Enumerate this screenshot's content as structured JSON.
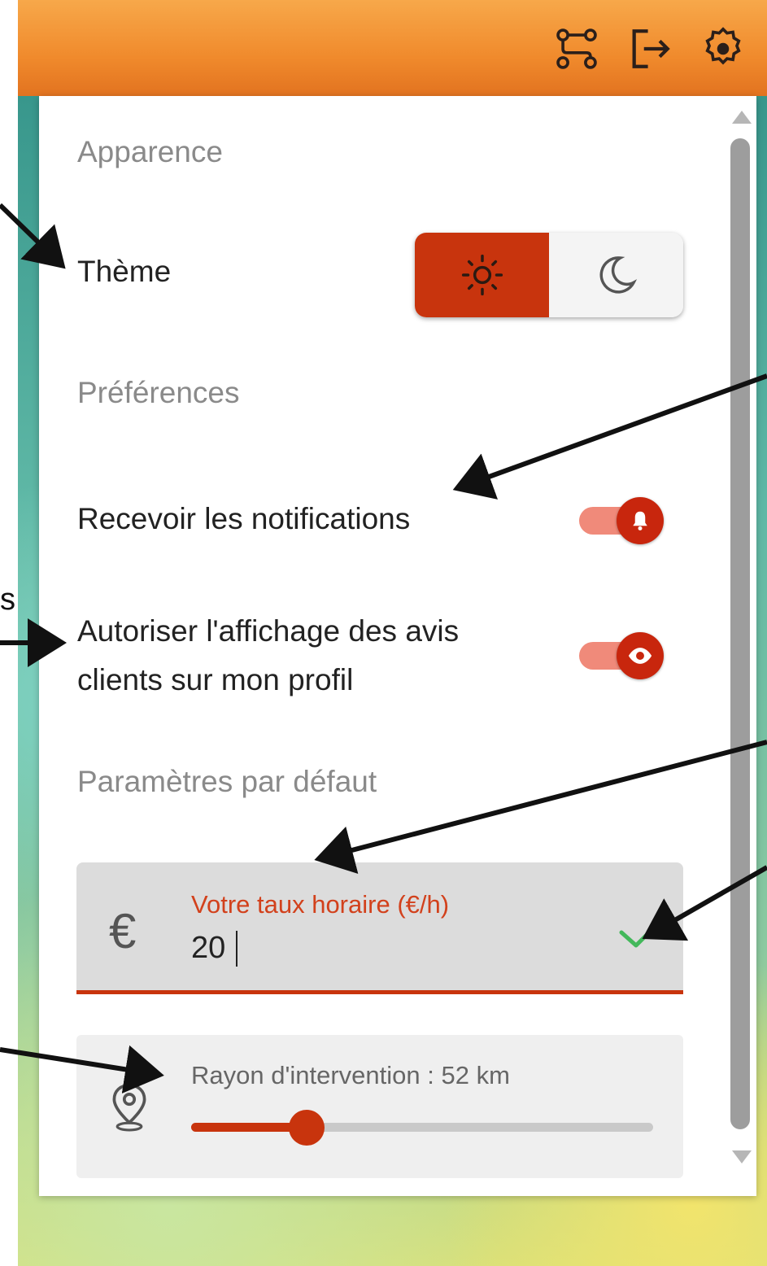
{
  "settings": {
    "section_appearance": "Apparence",
    "theme_label": "Thème",
    "theme_options": [
      "sun-icon",
      "moon-icon"
    ],
    "theme_selected": "light",
    "section_preferences": "Préférences",
    "notifications_label": "Recevoir les notifications",
    "notifications_on": true,
    "reviews_label_line1": "Autoriser l'affichage des avis",
    "reviews_label_line2": "clients sur mon profil",
    "reviews_on": true,
    "section_defaults": "Paramètres par défaut",
    "rate_label": "Votre taux horaire (€/h)",
    "rate_value": "20",
    "rate_currency_symbol": "€",
    "radius_label": "Rayon d'intervention : 52 km",
    "radius_fraction": 0.25
  },
  "annotation": {
    "partial_letter": "s"
  },
  "colors": {
    "accent": "#c8340d",
    "header": "#f08a2c",
    "check": "#43b85b"
  }
}
